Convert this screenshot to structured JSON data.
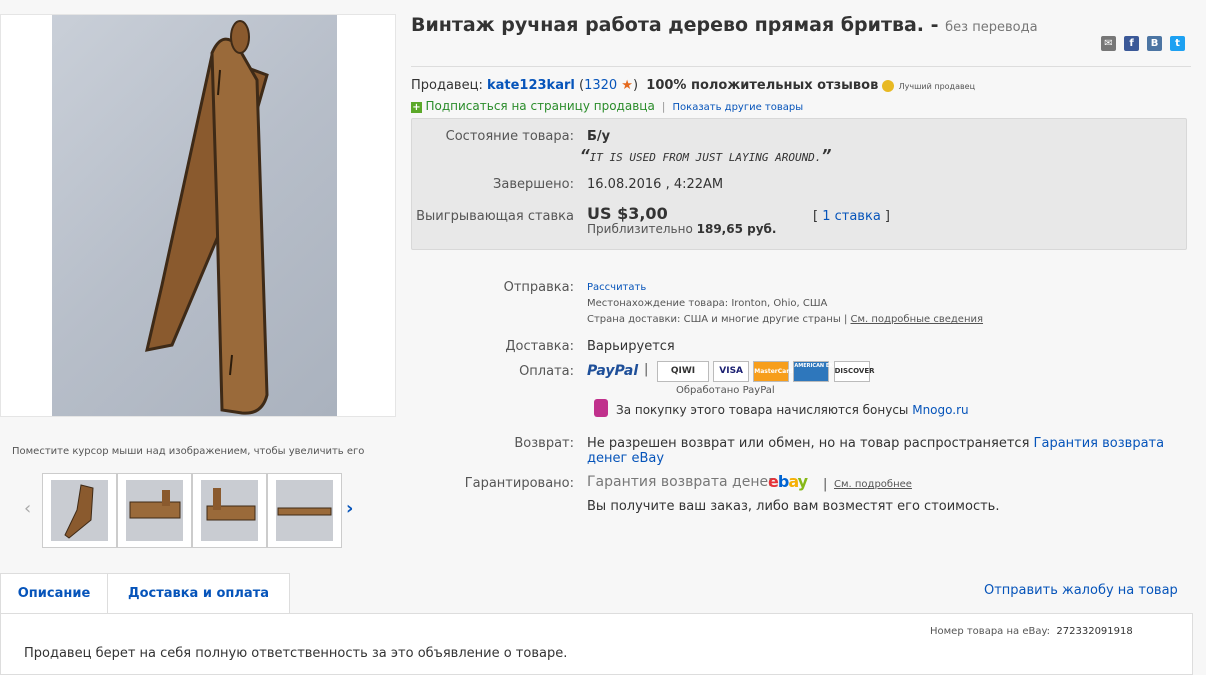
{
  "image_hint": "Поместите курсор мыши над изображением, чтобы увеличить его",
  "title": "Винтаж ручная работа дерево прямая бритва. -",
  "title_sub": "без перевода",
  "seller": {
    "label": "Продавец:",
    "name": "kate123karl",
    "score": "1320",
    "feedback": "100% положительных отзывов",
    "top_seller": "Лучший продавец",
    "subscribe": "Подписаться на страницу продавца",
    "other_items": "Показать другие товары"
  },
  "item": {
    "condition_label": "Состояние товара:",
    "condition": "Б/у",
    "condition_note": "IT IS USED FROM JUST LAYING AROUND.",
    "ended_label": "Завершено:",
    "ended": "16.08.2016 , 4:22AM",
    "bid_label": "Выигрывающая ставка",
    "price": "US $3,00",
    "approx_label": "Приблизительно",
    "approx": "189,65 руб.",
    "bids": "1 ставка"
  },
  "shipping": {
    "label": "Отправка:",
    "calc": "Рассчитать",
    "location": "Местонахождение товара: Ironton, Ohio, США",
    "countries": "Страна доставки: США и многие другие страны",
    "details": "См. подробные сведения",
    "delivery_label": "Доставка:",
    "delivery": "Варьируется",
    "payment_label": "Оплата:",
    "paypal": "PayPal",
    "processed": "Обработано PayPal",
    "mnogo_text": "За покупку этого товара начисляются бонусы",
    "mnogo_link": "Mnogo.ru",
    "returns_label": "Возврат:",
    "returns_text": "Не разрешен возврат или обмен, но на товар распространяется",
    "returns_link": "Гарантия возврата",
    "returns_link2": "денег eBay",
    "guarantee_label": "Гарантировано:",
    "guarantee_text": "Гарантия возврата денег",
    "guarantee_more": "См. подробнее",
    "guarantee_note": "Вы получите ваш заказ, либо вам возместят его стоимость."
  },
  "payment_badges": [
    "QIWI",
    "VISA",
    "MasterCard",
    "AMERICAN EXPRESS",
    "DISCOVER"
  ],
  "tabs": {
    "description": "Описание",
    "shipping": "Доставка и оплата",
    "report": "Отправить жалобу на товар"
  },
  "item_number_label": "Номер товара на eBay:",
  "item_number": "272332091918",
  "description_text": "Продавец берет на себя полную ответственность за это объявление о товаре.",
  "colors": {
    "link": "#0654ba",
    "star": "#e56a1e",
    "panel": "#e8e8e8"
  }
}
